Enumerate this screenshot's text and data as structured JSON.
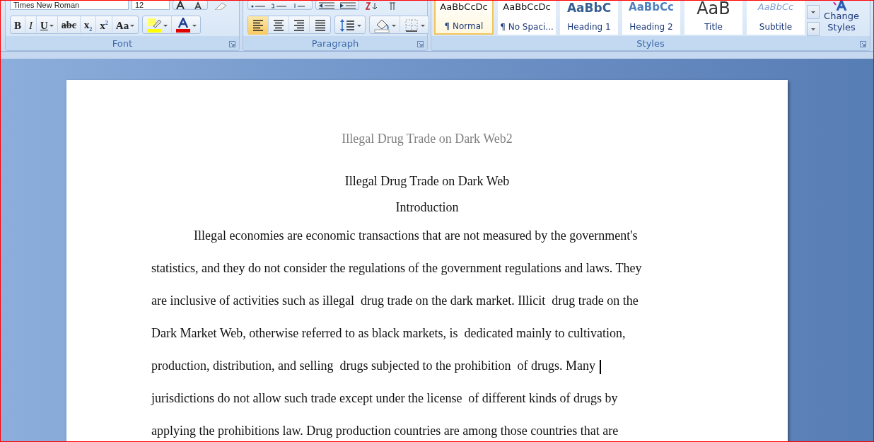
{
  "ribbon": {
    "font": {
      "name": "Times New Roman",
      "size": "12",
      "label": "Font",
      "buttons": [
        {
          "kind": "bold",
          "text": "B",
          "dropdown": false
        },
        {
          "kind": "italic",
          "text": "I",
          "dropdown": false
        },
        {
          "kind": "underline",
          "text": "U",
          "dropdown": true
        },
        {
          "kind": "strike",
          "text": "abc",
          "dropdown": false
        },
        {
          "kind": "sub",
          "text": "x$_{2}$",
          "dropdown": false
        },
        {
          "kind": "sup",
          "text": "x$^{2}$",
          "dropdown": false
        },
        {
          "kind": "case",
          "text": "Aa",
          "dropdown": true
        }
      ]
    },
    "paragraph": {
      "label": "Paragraph",
      "align_buttons": [
        {
          "kind": "left",
          "selected": true
        },
        {
          "kind": "center",
          "selected": false
        },
        {
          "kind": "right",
          "selected": false
        },
        {
          "kind": "justify",
          "selected": false
        }
      ]
    },
    "styles": {
      "label": "Styles",
      "change_styles": "Change Styles",
      "items": [
        {
          "kind": "normal",
          "preview": "AaBbCcDc",
          "label": "¶ Normal",
          "selected": true
        },
        {
          "kind": "normal",
          "preview": "AaBbCcDc",
          "label": "¶ No Spaci...",
          "selected": false
        },
        {
          "kind": "heading1",
          "preview": "AaBbC",
          "label": "Heading 1",
          "selected": false
        },
        {
          "kind": "heading2",
          "preview": "AaBbCc",
          "label": "Heading 2",
          "selected": false
        },
        {
          "kind": "title",
          "preview": "AaB",
          "label": "Title",
          "selected": false
        },
        {
          "kind": "subtitle",
          "preview": "AaBbCc",
          "label": "Subtitle",
          "selected": false
        }
      ]
    }
  },
  "document": {
    "header": "Illegal Drug Trade on Dark Web2",
    "title": "Illegal Drug Trade on Dark Web",
    "section_heading": "Introduction",
    "lines": [
      {
        "text": "Illegal economies are economic transactions that are not measured by the government's",
        "cursor": false
      },
      {
        "text": "statistics, and they do not consider the regulations of the government regulations and laws. They",
        "cursor": false
      },
      {
        "text": "are inclusive of activities such as illegal  drug trade on the dark market. Illicit  drug trade on the",
        "cursor": false
      },
      {
        "text": "Dark Market Web, otherwise referred to as black markets, is  dedicated mainly to cultivation,",
        "cursor": false
      },
      {
        "text": "production, distribution, and selling  drugs subjected to the prohibition  of drugs. Many",
        "cursor": true
      },
      {
        "text": "jurisdictions do not allow such trade except under the license  of different kinds of drugs by",
        "cursor": false
      },
      {
        "text": "applying the prohibitions law. Drug production countries are among those countries that are",
        "cursor": false
      }
    ]
  }
}
